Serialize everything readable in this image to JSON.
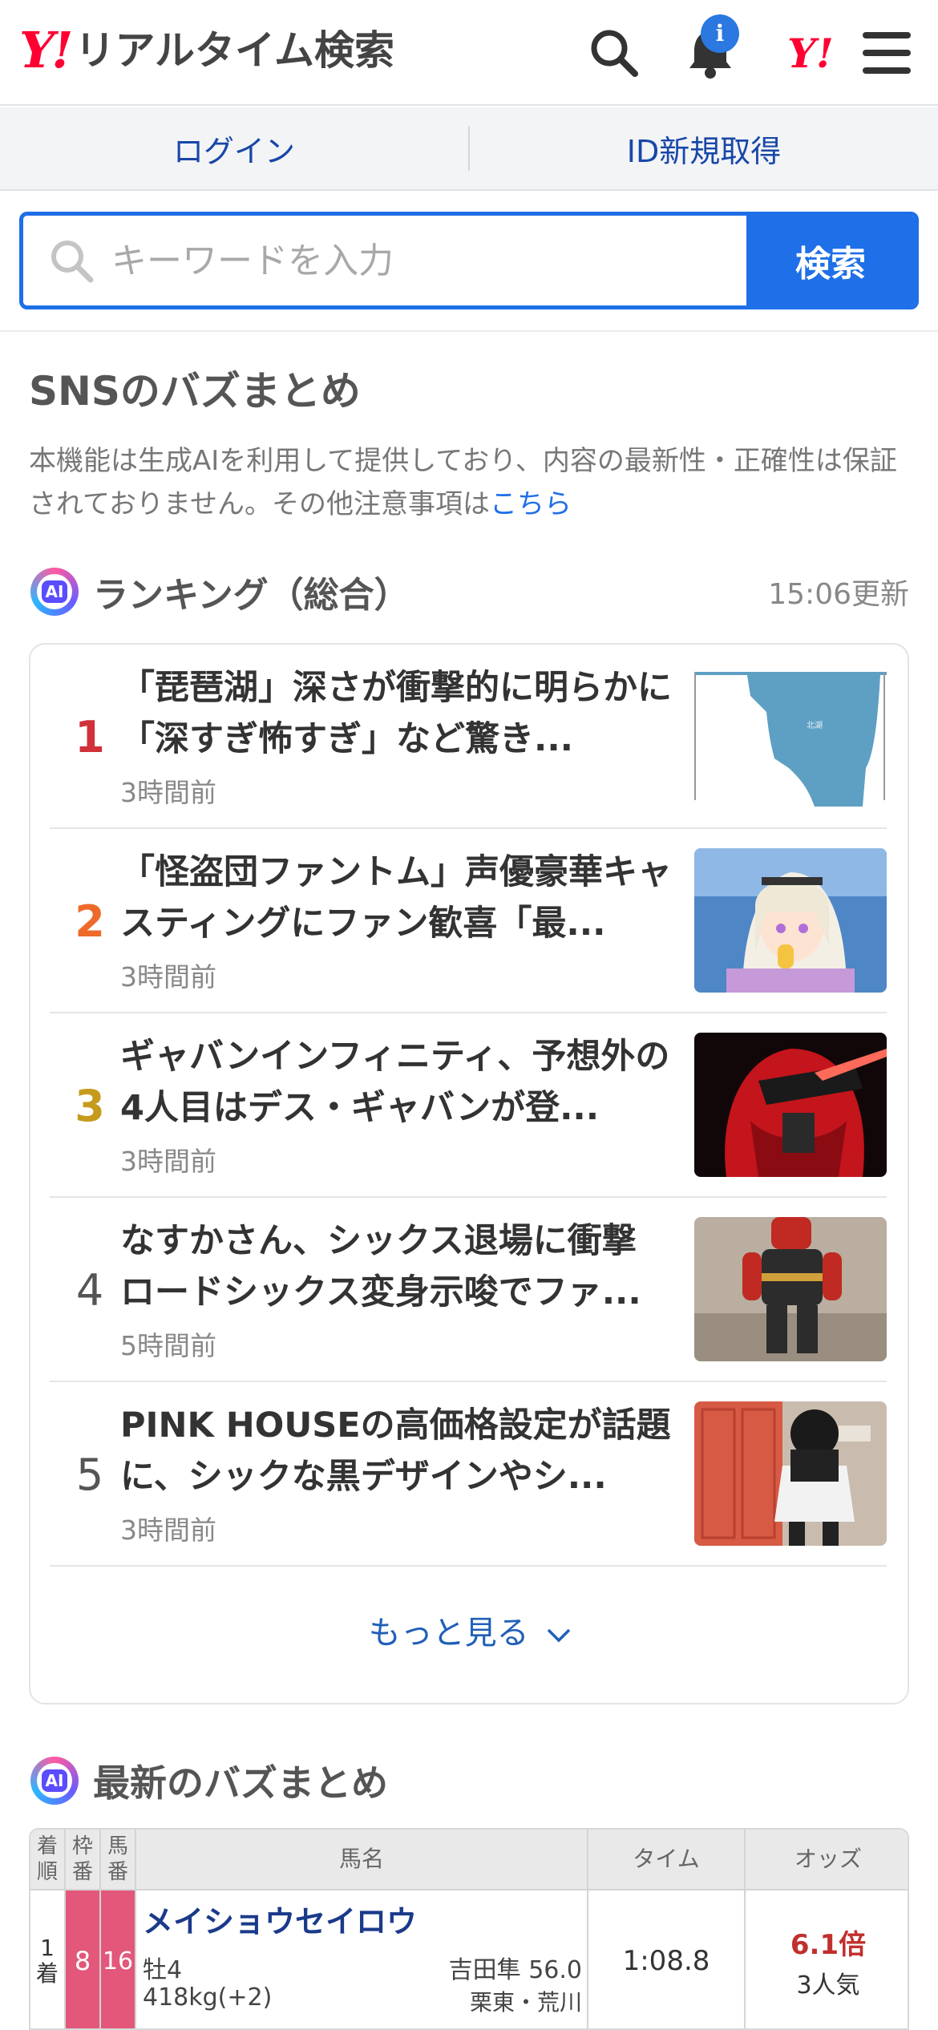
{
  "header": {
    "logo_mark": "Y!",
    "logo_text": "リアルタイム検索",
    "notification_badge": "i",
    "yahoo_mark": "Y!"
  },
  "account": {
    "login": "ログイン",
    "register": "ID新規取得"
  },
  "search": {
    "placeholder": "キーワードを入力",
    "button": "検索"
  },
  "section": {
    "title": "SNSのバズまとめ",
    "notice": "本機能は生成AIを利用して提供しており、内容の最新性・正確性は保証されておりません。その他注意事項は",
    "notice_link": "こちら"
  },
  "ranking": {
    "ai_label": "AI",
    "title": "ランキング（総合）",
    "updated": "15:06更新",
    "items": [
      {
        "rank": "1",
        "title": "「琵琶湖」深さが衝撃的に明らかに 「深すぎ怖すぎ」など驚き...",
        "time": "3時間前",
        "color": "#d0313a"
      },
      {
        "rank": "2",
        "title": "「怪盗団ファントム」声優豪華キャスティングにファン歓喜「最...",
        "time": "3時間前",
        "color": "#ee6a2a"
      },
      {
        "rank": "3",
        "title": "ギャバンインフィニティ、予想外の4人目はデス・ギャバンが登...",
        "time": "3時間前",
        "color": "#c69a1c"
      },
      {
        "rank": "4",
        "title": "なすかさん、シックス退場に衝撃 ロードシックス変身示唆でファ...",
        "time": "5時間前",
        "color": "#555555"
      },
      {
        "rank": "5",
        "title": "PINK HOUSEの高価格設定が話題に、シックな黒デザインやシ...",
        "time": "3時間前",
        "color": "#555555"
      }
    ],
    "thumb_label": "北湖",
    "more": "もっと見る"
  },
  "buzz": {
    "ai_label": "AI",
    "title": "最新のバズまとめ"
  },
  "race": {
    "headers": {
      "place": "着順",
      "frame": "枠番",
      "horse_no": "馬番",
      "name": "馬名",
      "time": "タイム",
      "odds": "オッズ"
    },
    "row": {
      "place": "1着",
      "frame": "8",
      "horse_no": "16",
      "name": "メイショウセイロウ",
      "sex_age": "牡4",
      "jockey_weight": "吉田隼 56.0",
      "body_weight": "418kg(+2)",
      "stable": "栗東・荒川",
      "time": "1:08.8",
      "odds": "6.1倍",
      "popularity": "3人気"
    }
  }
}
